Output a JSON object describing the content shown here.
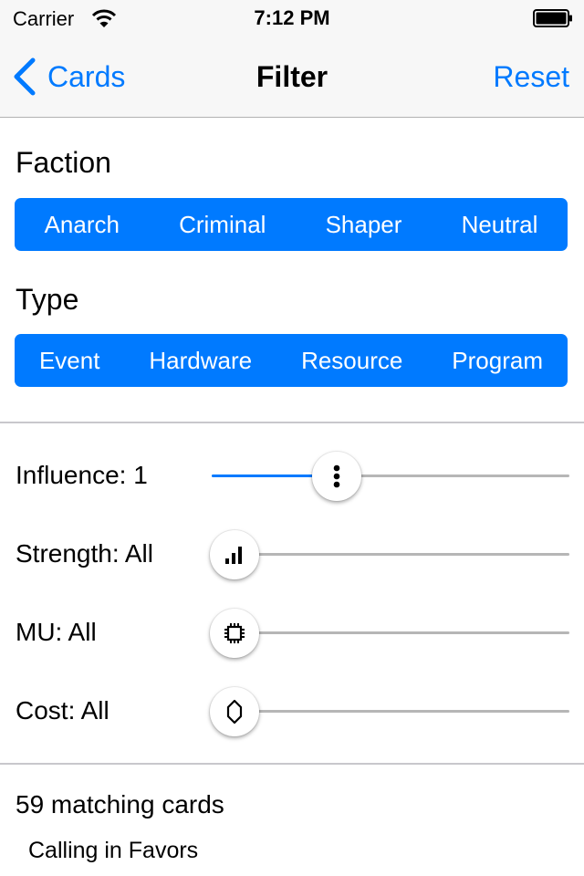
{
  "status_bar": {
    "carrier": "Carrier",
    "time": "7:12 PM"
  },
  "nav": {
    "back_label": "Cards",
    "title": "Filter",
    "reset_label": "Reset"
  },
  "faction": {
    "label": "Faction",
    "options": [
      "Anarch",
      "Criminal",
      "Shaper",
      "Neutral"
    ]
  },
  "type": {
    "label": "Type",
    "options": [
      "Event",
      "Hardware",
      "Resource",
      "Program"
    ]
  },
  "sliders": [
    {
      "label": "Influence: 1",
      "icon": "influence-icon",
      "value_fraction": 0.35
    },
    {
      "label": "Strength: All",
      "icon": "signal-bars-icon",
      "value_fraction": 0.0
    },
    {
      "label": "MU: All",
      "icon": "chip-icon",
      "value_fraction": 0.0
    },
    {
      "label": "Cost: All",
      "icon": "hexagon-credit-icon",
      "value_fraction": 0.0
    }
  ],
  "results": {
    "count_text": "59 matching cards",
    "items": [
      "Calling in Favors"
    ]
  },
  "colors": {
    "accent": "#007aff",
    "track": "#b6b6b6",
    "bar_bg": "#f7f7f7"
  }
}
